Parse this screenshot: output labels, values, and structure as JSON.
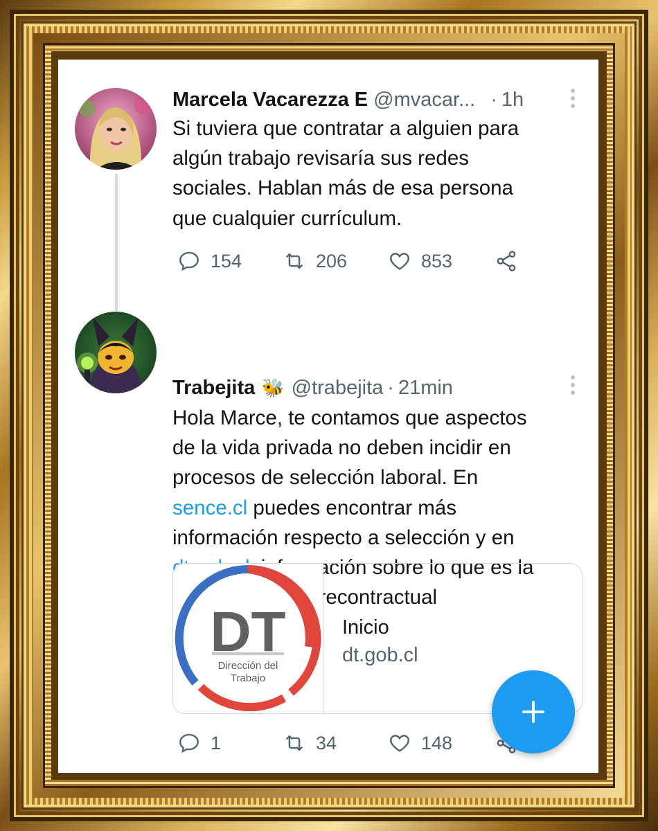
{
  "tweet1": {
    "name": "Marcela Vacarezza E",
    "handle": "@mvacar...",
    "separator": "·",
    "time": "1h",
    "lines": [
      "Si tuviera que contratar a alguien para",
      "algún trabajo revisaría sus redes",
      "sociales. Hablan más de esa persona",
      "que cualquier currículum."
    ],
    "replies": "154",
    "retweets": "206",
    "likes": "853"
  },
  "tweet2": {
    "name": "Trabejita",
    "emoji": "🐝",
    "handle": "@trabejita",
    "separator": "·",
    "time": "21min",
    "text": {
      "l1": "Hola Marce, te contamos que aspectos",
      "l2": "de la vida privada no deben incidir en",
      "l3": "procesos de selección laboral. En",
      "l4_link": "sence.cl",
      "l4_rest": " puedes encontrar más",
      "l5": "información respecto a selección y en",
      "l6_link": "dt.gob.cl",
      "l6_rest": ", información sobre lo que es la",
      "l7": "discriminación precontractual"
    },
    "card": {
      "logo_text": "DT",
      "logo_caption_1": "Dirección del",
      "logo_caption_2": "Trabajo",
      "title": "Inicio",
      "domain": "dt.gob.cl"
    },
    "replies": "1",
    "retweets": "34",
    "likes": "148"
  },
  "fab": {
    "icon": "plus-icon"
  },
  "colors": {
    "link": "#1d9bf0",
    "text": "#0f1419",
    "muted": "#536471",
    "frame_gold": "#d9b25a"
  }
}
